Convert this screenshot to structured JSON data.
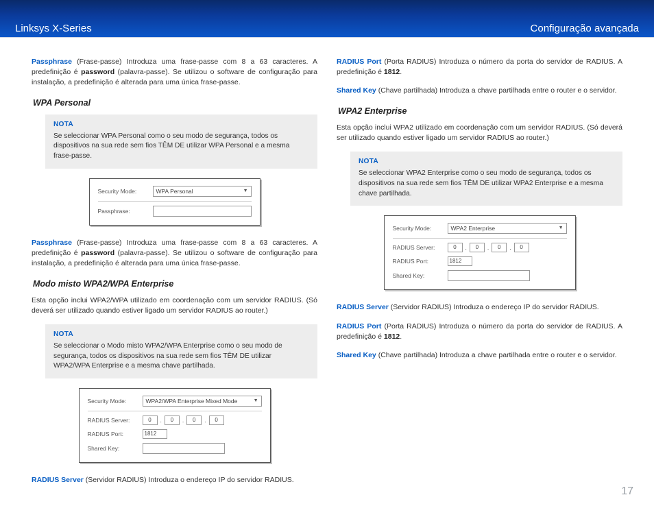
{
  "header": {
    "left": "Linksys X-Series",
    "right": "Configuração avançada"
  },
  "page_number": "17",
  "labels": {
    "nota": "NOTA",
    "security_mode": "Security Mode:",
    "passphrase": "Passphrase:",
    "radius_server": "RADIUS Server:",
    "radius_port": "RADIUS Port:",
    "shared_key": "Shared Key:"
  },
  "dropdown": {
    "wpa_personal": "WPA Personal",
    "wpa2_mixed": "WPA2/WPA Enterprise Mixed Mode",
    "wpa2_enterprise": "WPA2 Enterprise"
  },
  "values": {
    "ip": [
      "0",
      "0",
      "0",
      "0"
    ],
    "port": "1812"
  },
  "left": {
    "p1": {
      "lead": "Passphrase",
      "rest": "  (Frase-passe) Introduza uma frase-passe com 8 a 63 caracteres. A predefinição é ",
      "bold": "password",
      "rest2": " (palavra-passe). Se utilizou o software de configuração para instalação, a predefinição é alterada para uma única frase-passe."
    },
    "h1": "WPA Personal",
    "nota1": "Se seleccionar WPA Personal como o seu modo de segurança, todos os dispositivos na sua rede sem fios TÊM DE utilizar WPA Personal e a mesma frase-passe.",
    "p2": {
      "lead": "Passphrase",
      "rest": "  (Frase-passe) Introduza uma frase-passe com 8 a 63 caracteres. A predefinição é ",
      "bold": "password",
      "rest2": " (palavra-passe). Se utilizou o software de configuração para instalação, a predefinição é alterada para uma única frase-passe."
    },
    "h2": "Modo misto WPA2/WPA Enterprise",
    "p3": "Esta opção inclui WPA2/WPA utilizado em coordenação com um servidor RADIUS. (Só deverá ser utilizado quando estiver ligado um servidor RADIUS ao router.)",
    "nota2": "Se seleccionar o Modo misto WPA2/WPA Enterprise como o seu modo de segurança, todos os dispositivos na sua rede sem fios TÊM DE utilizar WPA2/WPA Enterprise e a mesma chave partilhada.",
    "p4": {
      "lead": "RADIUS Server",
      "rest": " (Servidor RADIUS)   Introduza o endereço IP do servidor RADIUS."
    }
  },
  "right": {
    "p1": {
      "lead": "RADIUS Port",
      "rest": " (Porta RADIUS) Introduza o número da porta do servidor de RADIUS. A predefinição é ",
      "bold": "1812",
      "rest2": "."
    },
    "p2": {
      "lead": "Shared Key",
      "rest": "  (Chave partilhada) Introduza a chave partilhada entre o router e o servidor."
    },
    "h1": "WPA2 Enterprise",
    "p3": "Esta opção inclui WPA2 utilizado em coordenação com um servidor RADIUS. (Só deverá ser utilizado quando estiver ligado um servidor RADIUS ao router.)",
    "nota1": "Se seleccionar WPA2 Enterprise como o seu modo de segurança, todos os dispositivos na sua rede sem fios TÊM DE utilizar WPA2 Enterprise e a mesma chave partilhada.",
    "p4": {
      "lead": "RADIUS Server",
      "rest": " (Servidor RADIUS) Introduza o endereço IP do servidor RADIUS."
    },
    "p5": {
      "lead": "RADIUS Port",
      "rest": " (Porta RADIUS) Introduza o número da porta do servidor de RADIUS. A predefinição é ",
      "bold": "1812",
      "rest2": "."
    },
    "p6": {
      "lead": "Shared Key",
      "rest": "  (Chave partilhada) Introduza a chave partilhada entre o router e o servidor."
    }
  }
}
